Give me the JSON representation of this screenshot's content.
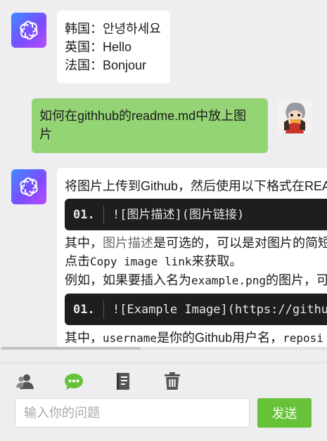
{
  "messages": [
    {
      "role": "assistant",
      "lines": [
        "韩国：안녕하세요",
        "英国：Hello",
        "法国：Bonjour"
      ]
    },
    {
      "role": "user",
      "lines": [
        "如何在githhub的readme.md中放上图",
        "片"
      ]
    },
    {
      "role": "assistant",
      "intro": "将图片上传到Github，然后使用以下格式在README",
      "code1": {
        "line_no": "01.",
        "code": "![图片描述](图片链接)"
      },
      "para1_a": "其中，",
      "para1_b": "图片描述",
      "para1_c": "是可选的，可以是对图片的简短",
      "para2_a": "点击",
      "para2_b": "Copy image link",
      "para2_c": "来获取。",
      "para3_a": "例如，如果要插入名为",
      "para3_b": "example.png",
      "para3_c": "的图片，可",
      "code2": {
        "line_no": "01.",
        "code": "![Example Image](https://github"
      },
      "para4_a": "其中，",
      "para4_b": "username",
      "para4_c": "是你的Github用户名，",
      "para4_d": "reposi"
    }
  ],
  "toolbar": {
    "icons": [
      "user-icon",
      "chat-icon",
      "document-icon",
      "trash-icon"
    ],
    "accent": "#67c23a"
  },
  "input": {
    "placeholder": "输入你的问题",
    "value": ""
  },
  "send_label": "发送"
}
